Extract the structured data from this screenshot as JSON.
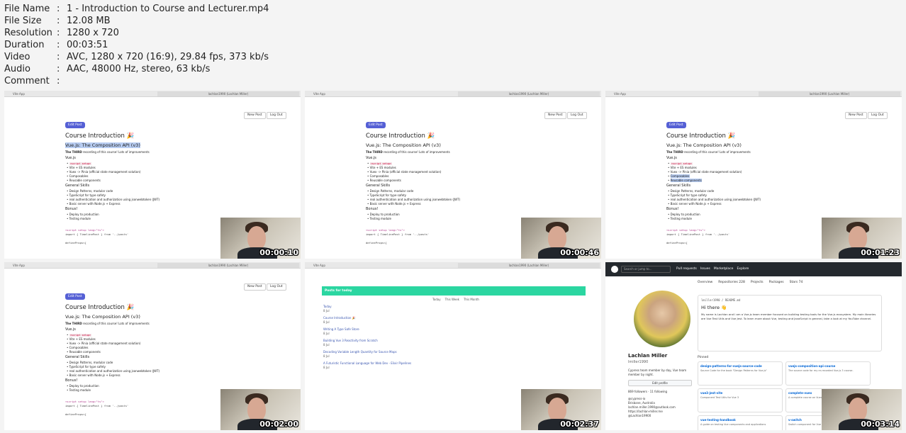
{
  "info": [
    {
      "key": "File Name",
      "value": "1 - Introduction to Course and Lecturer.mp4"
    },
    {
      "key": "File Size",
      "value": "12.08 MB"
    },
    {
      "key": "Resolution",
      "value": "1280 x 720"
    },
    {
      "key": "Duration",
      "value": "00:03:51"
    },
    {
      "key": "Video",
      "value": "AVC, 1280 x 720 (16:9), 29.84 fps, 373 kb/s"
    },
    {
      "key": "Audio",
      "value": "AAC, 48000 Hz, stereo, 63 kb/s"
    },
    {
      "key": "Comment",
      "value": ""
    }
  ],
  "thumbs": {
    "t1": "00:00:10",
    "t2": "00:00:46",
    "t3": "00:01:23",
    "t4": "00:02:00",
    "t5": "00:02:37",
    "t6": "00:03:14"
  },
  "browser": {
    "tab1": "Vite App",
    "tab2": "lachlan1990 (Lachlan Miller)"
  },
  "doc": {
    "new_post": "New Post",
    "log_out": "Log Out",
    "edit_post": "Edit Post",
    "title": "Course Introduction 🎉",
    "subtitle": "Vue.js: The Composition API (v3)",
    "intro_bold": "The THIRD",
    "intro_rest": " recording of this course! Lots of improvements",
    "vue_heading": "Vue.js",
    "vue_items": [
      "<script setup>",
      "Vite + ES modules",
      "Vuex -> Pinia (official state management solution)",
      "Composables",
      "Reusable components"
    ],
    "general_heading": "General Skills",
    "general_items": [
      "Design Patterns, modular code",
      "TypeScript for type safety",
      "real authentication and authorization using jsonwebtoken (JWT)",
      "Basic server with Node.js + Express"
    ],
    "bonus_heading": "Bonus!",
    "bonus_items": [
      "Deploy to production",
      "Testing module"
    ],
    "code1": "<script setup lang=\"ts\">",
    "code2": "import { TimelinePost } from '../posts'",
    "code3": "defineProps<{"
  },
  "posts": {
    "header": "Posts for today",
    "tabs": [
      "Today",
      "This Week",
      "This Month"
    ],
    "items": [
      {
        "title": "Today",
        "date": "8 Jul"
      },
      {
        "title": "Course Introduction 🎉",
        "date": "8 Jul"
      },
      {
        "title": "Writing A Type Safe Store",
        "date": "8 Jul"
      },
      {
        "title": "Building Vue 3 Reactivity from Scratch",
        "date": "8 Jul"
      },
      {
        "title": "Decoding Variable Length Quantity for Source Maps",
        "date": "8 Jul"
      },
      {
        "title": "A Futuristic Functional Language for Web Dev - Elixir Pipelines",
        "date": "8 Jul"
      }
    ]
  },
  "github": {
    "search": "Search or jump to...",
    "nav": [
      "Pull requests",
      "Issues",
      "Marketplace",
      "Explore"
    ],
    "tabs": [
      "Overview",
      "Repositories 228",
      "Projects",
      "Packages",
      "Stars 74"
    ],
    "name": "Lachlan Miller",
    "user": "lmiller1990",
    "bio": "Cypress team member by day, Vue team member by night.",
    "edit_profile": "Edit profile",
    "followers": "869 followers · 11 following",
    "org": "@cypress-io",
    "location": "Brisbane, Australia",
    "email": "lachlan.miller.1990@outlook.com",
    "site": "https://lachlan-miller.me",
    "twitter": "@Lachlan19900",
    "readme_file": "lmiller1990 / README.md",
    "readme_hi": "Hi there 👋",
    "readme_text": "My name is Lachlan and I am a Vue.js team member focused on building testing tools for the Vue.js ecosystem. My main libraries are Vue Test Utils and Vue Jest. To learn more about Vue, testing and JavaScript in general, take a look at my YouTube channel.",
    "pinned": "Pinned",
    "cards": [
      {
        "name": "design-patterns-for-vuejs-source-code",
        "desc": "Source Code for the book \"Design Patterns for Vue.js\""
      },
      {
        "name": "vuejs-composition-api-course",
        "desc": "The source code for my re-recorded Vue.js 3 course."
      },
      {
        "name": "vue3-jest-vite",
        "desc": "Component Test Utils for Vue 3"
      },
      {
        "name": "complete-vuex",
        "desc": "A complete course on Vuex"
      },
      {
        "name": "vue-testing-handbook",
        "desc": "A guide on testing Vue components and applications"
      },
      {
        "name": "v-switch",
        "desc": "Switch component for Vue"
      }
    ]
  }
}
